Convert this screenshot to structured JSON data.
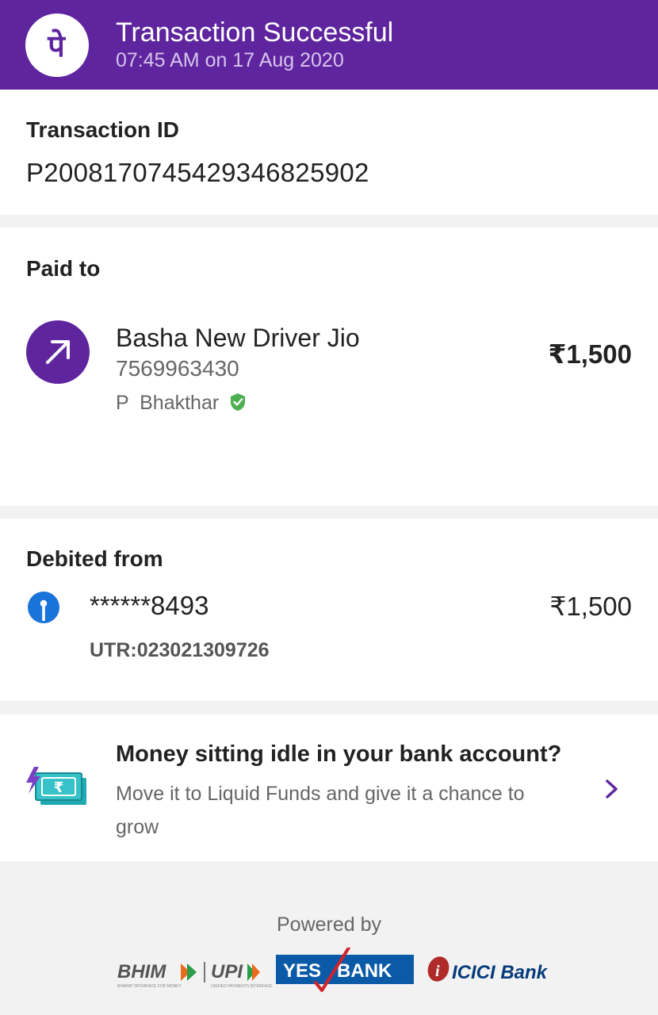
{
  "header": {
    "title": "Transaction Successful",
    "subtitle": "07:45 AM on 17 Aug 2020",
    "logo_icon": "phonepe-logo-icon",
    "logo_glyph": "पे"
  },
  "transaction": {
    "label": "Transaction ID",
    "id": "P2008170745429346825902"
  },
  "paid_to": {
    "label": "Paid to",
    "icon": "arrow-up-right-icon",
    "name": "Basha New Driver Jio",
    "phone": "7569963430",
    "verified_name": "P  Bhakthar",
    "verified_icon": "verified-shield-icon",
    "amount": "₹1,500"
  },
  "debited_from": {
    "label": "Debited from",
    "bank_icon": "sbi-bank-icon",
    "account": "******8493",
    "amount": "₹1,500",
    "utr": "UTR:023021309726"
  },
  "promo": {
    "icon": "money-bolt-icon",
    "title": "Money sitting idle in your bank account?",
    "description": "Move it to Liquid Funds and give it a chance to grow",
    "chevron_icon": "chevron-right-icon"
  },
  "footer": {
    "powered_by": "Powered by",
    "bhim": "BHIM",
    "upi": "UPI",
    "bhim_tagline": "BHARAT INTERFACE FOR MONEY",
    "upi_tagline": "UNIFIED PAYMENTS INTERFACE",
    "yes_bank": "YES   BANK",
    "icici": "ICICI Bank"
  },
  "colors": {
    "brand_purple": "#5f259f",
    "verified_green": "#4caf50",
    "sbi_blue": "#1a73d9",
    "promo_teal": "#1fa9b0",
    "yes_blue": "#0b5aa8",
    "icici_maroon": "#b02a2a",
    "icici_blue": "#063b7a"
  }
}
